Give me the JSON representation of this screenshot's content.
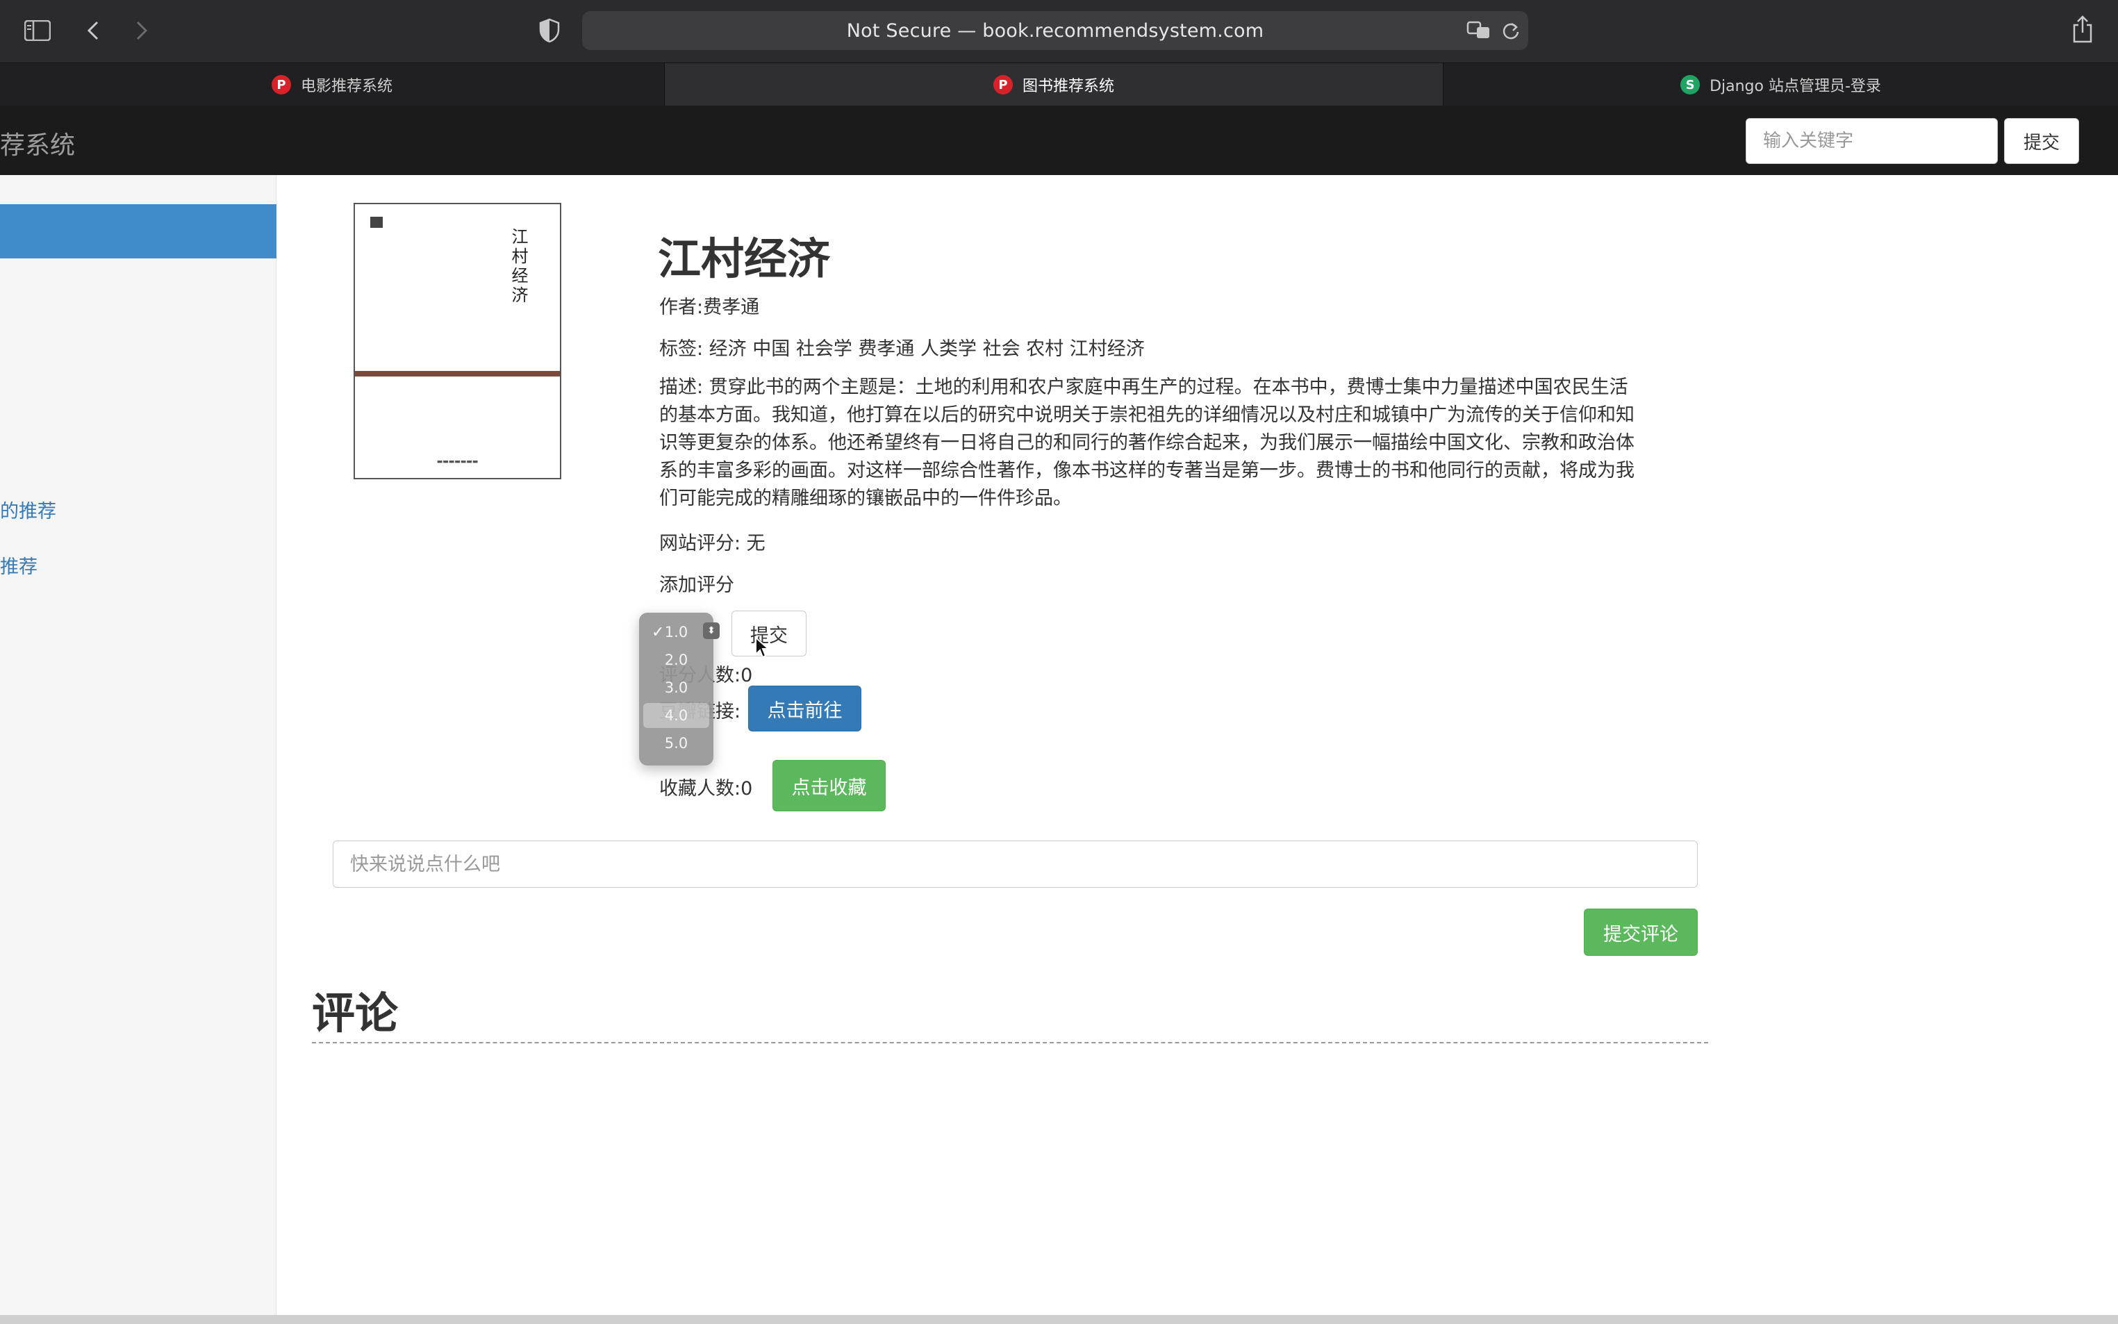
{
  "browser": {
    "address": "Not Secure — book.recommendsystem.com",
    "icons": [
      "sidebar-icon",
      "back-icon",
      "forward-icon",
      "shield-icon",
      "translate-icon",
      "reload-icon",
      "share-icon"
    ],
    "tabs": [
      {
        "label": "电影推荐系统",
        "favicon": "P",
        "active": false
      },
      {
        "label": "图书推荐系统",
        "favicon": "P",
        "active": true
      },
      {
        "label": "Django 站点管理员-登录",
        "favicon": "S",
        "active": false
      }
    ]
  },
  "navbar": {
    "brand": "荐系统",
    "search_placeholder": "输入关键字",
    "submit_label": "提交"
  },
  "sidebar": {
    "links": [
      "的推荐",
      "推荐"
    ]
  },
  "book": {
    "title": "江村经济",
    "author_line": "作者:费孝通",
    "tags_line": "标签: 经济 中国 社会学 费孝通 人类学 社会 农村 江村经济",
    "description": "描述: 贯穿此书的两个主题是：土地的利用和农户家庭中再生产的过程。在本书中，费博士集中力量描述中国农民生活的基本方面。我知道，他打算在以后的研究中说明关于崇祀祖先的详细情况以及村庄和城镇中广为流传的关于信仰和知识等更复杂的体系。他还希望终有一日将自己的和同行的著作综合起来，为我们展示一幅描绘中国文化、宗教和政治体系的丰富多彩的画面。对这样一部综合性著作，像本书这样的专著当是第一步。费博士的书和他同行的贡献，将成为我们可能完成的精雕细琢的镶嵌品中的一件件珍品。",
    "site_rating_line": "网站评分: 无",
    "cover_title": "江村经济"
  },
  "rating": {
    "add_label": "添加评分",
    "options": [
      "1.0",
      "2.0",
      "3.0",
      "4.0",
      "5.0"
    ],
    "selected": "1.0",
    "hovered": "4.0",
    "submit_label": "提交",
    "raters_line": "评分人数:0"
  },
  "douban": {
    "label": "豆瓣链接:",
    "button": "点击前往"
  },
  "collect": {
    "count_line": "收藏人数:0",
    "button": "点击收藏"
  },
  "comment": {
    "placeholder": "快来说说点什么吧",
    "submit_label": "提交评论",
    "section_title": "评论"
  },
  "colors": {
    "primary": "#337ab7",
    "success": "#5cb85c",
    "navbar": "#1b1b1b",
    "sidebar_active": "#428bca"
  }
}
